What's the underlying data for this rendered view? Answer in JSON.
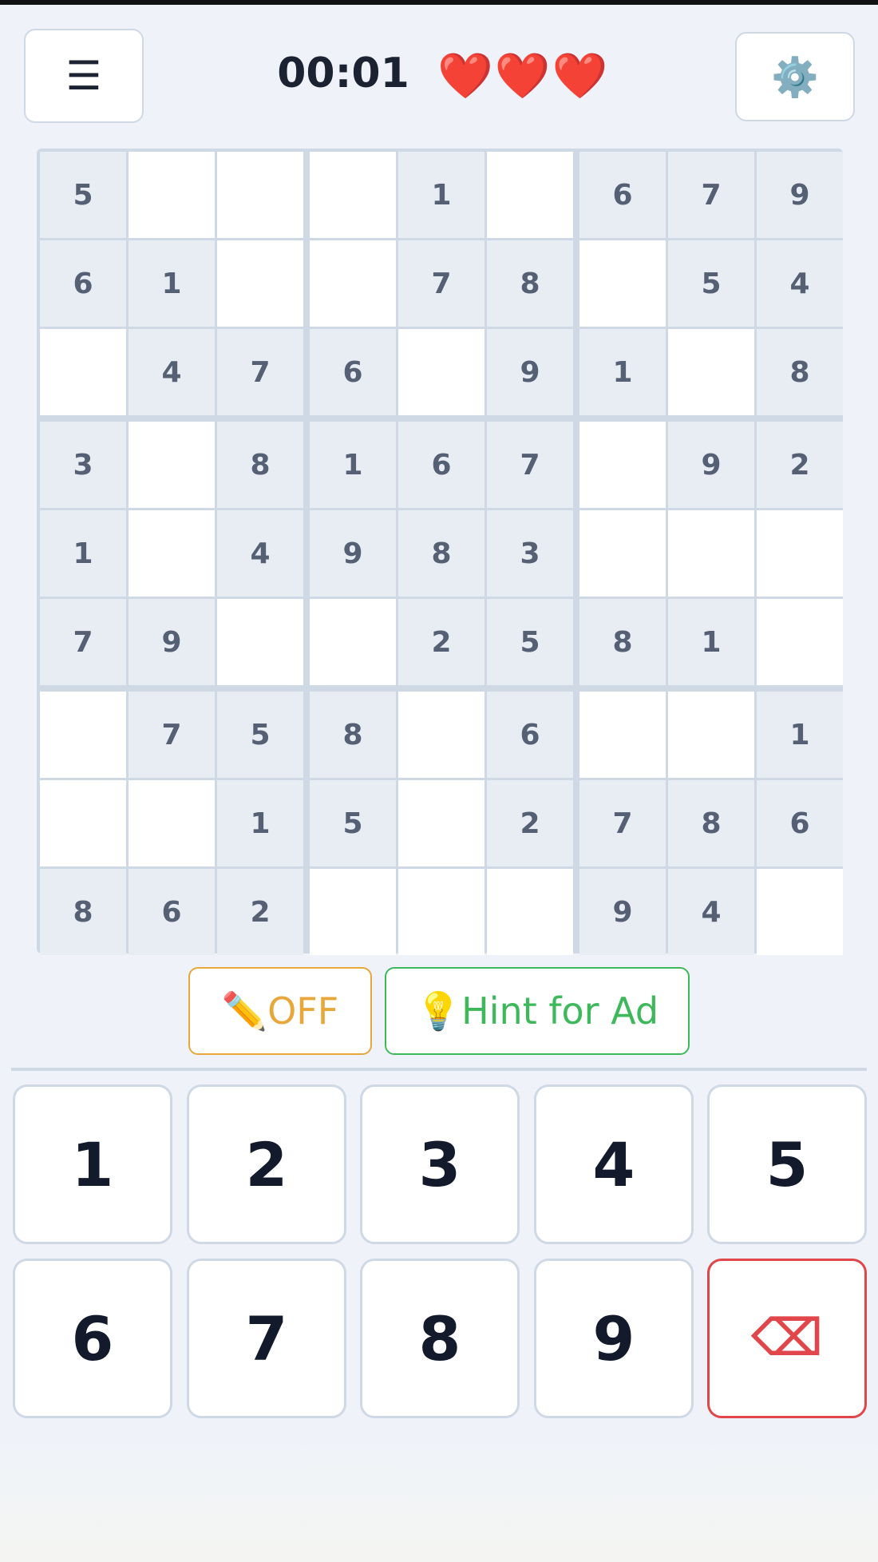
{
  "header": {
    "menu_icon": "☰",
    "timer": "00:01",
    "lives": [
      "❤️",
      "❤️",
      "❤️"
    ],
    "settings_icon": "⚙️"
  },
  "board": {
    "grid": [
      [
        "5",
        "",
        "",
        "",
        "1",
        "",
        "6",
        "7",
        "9"
      ],
      [
        "6",
        "1",
        "",
        "",
        "7",
        "8",
        "",
        "5",
        "4"
      ],
      [
        "",
        "4",
        "7",
        "6",
        "",
        "9",
        "1",
        "",
        "8"
      ],
      [
        "3",
        "",
        "8",
        "1",
        "6",
        "7",
        "",
        "9",
        "2"
      ],
      [
        "1",
        "",
        "4",
        "9",
        "8",
        "3",
        "",
        "",
        ""
      ],
      [
        "7",
        "9",
        "",
        "",
        "2",
        "5",
        "8",
        "1",
        ""
      ],
      [
        "",
        "7",
        "5",
        "8",
        "",
        "6",
        "",
        "",
        "1"
      ],
      [
        "",
        "",
        "1",
        "5",
        "",
        "2",
        "7",
        "8",
        "6"
      ],
      [
        "8",
        "6",
        "2",
        "",
        "",
        "",
        "9",
        "4",
        ""
      ]
    ]
  },
  "controls": {
    "pencil_label": "✏️OFF",
    "hint_label": "💡Hint for Ad"
  },
  "numpad": {
    "keys": [
      "1",
      "2",
      "3",
      "4",
      "5",
      "6",
      "7",
      "8",
      "9"
    ],
    "erase_icon": "⌫"
  },
  "colors": {
    "accent_orange": "#e8a73a",
    "accent_green": "#3fb85c",
    "erase_red": "#e0464a",
    "given_cell": "#e8edf4",
    "empty_cell": "#ffffff"
  }
}
